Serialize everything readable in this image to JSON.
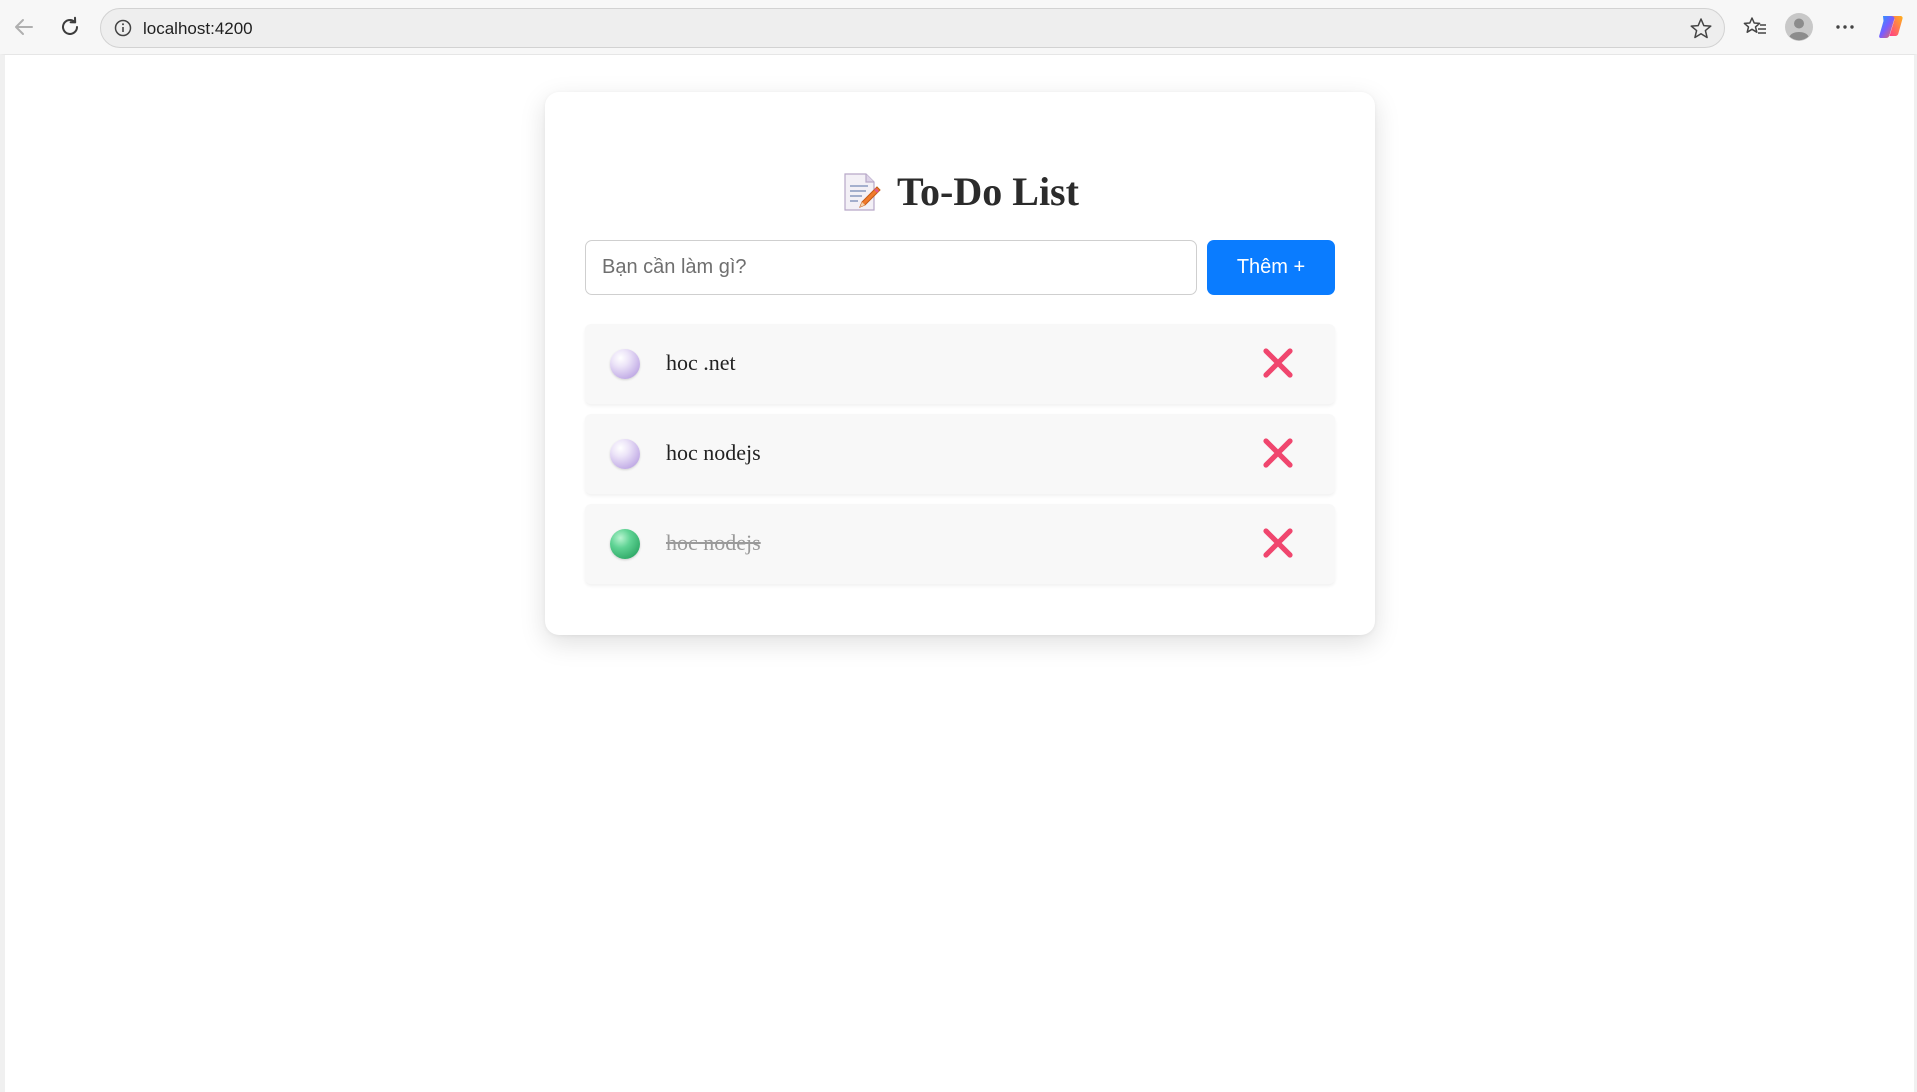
{
  "browser": {
    "url": "localhost:4200",
    "icons": {
      "back": "back-arrow-icon",
      "reload": "reload-icon",
      "info": "info-icon",
      "favorite": "star-icon",
      "favorites_list": "favorites-icon",
      "profile": "profile-icon",
      "more": "more-icon",
      "copilot": "copilot-icon"
    }
  },
  "app": {
    "title": "To-Do List",
    "title_icon": "memo-icon",
    "input_placeholder": "Bạn cần làm gì?",
    "add_button_label": "Thêm +",
    "accent_color": "#0a7cff",
    "delete_color": "#f0466e"
  },
  "todos": [
    {
      "text": "hoc .net",
      "done": false
    },
    {
      "text": "hoc nodejs",
      "done": false
    },
    {
      "text": "hoc nodejs",
      "done": true
    }
  ]
}
